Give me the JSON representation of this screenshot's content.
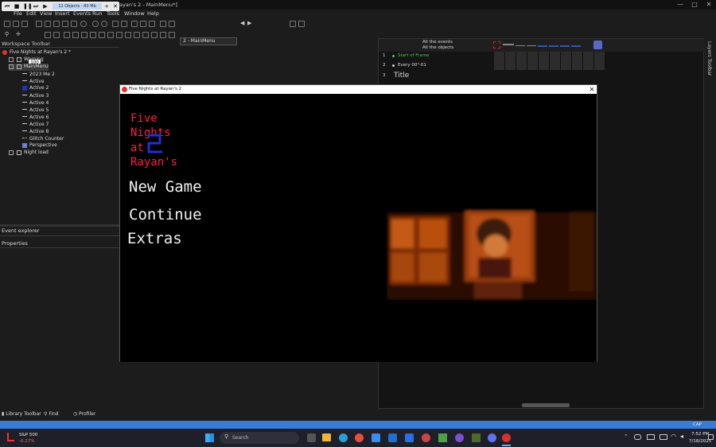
{
  "window": {
    "title": "ayan's 2 - MainMenu*]",
    "controls": [
      "—",
      "□",
      "✕"
    ]
  },
  "preview_toolbar": {
    "badge": "11 Objects - 80 Mb",
    "plus": "+",
    "close": "✕"
  },
  "menu": [
    "File",
    "Edit",
    "View",
    "Insert",
    "Events",
    "Run",
    "Tools",
    "Window",
    "Help"
  ],
  "toolbar": {
    "frame_select": "2 - MainMenu",
    "zoom": "100"
  },
  "workspace": {
    "title": "Workspace Toolbar",
    "project": "Five Nights at Rayan's 2 *",
    "frames": [
      {
        "label": "Warning"
      },
      {
        "label": "MainMenu"
      },
      {
        "label": "Night load"
      }
    ],
    "objects": [
      "2023 Me 2",
      "Active",
      "Active 2",
      "Active 3",
      "Active 4",
      "Active 5",
      "Active 6",
      "Active 7",
      "Active 8",
      "Glitch Counter",
      "Perspective"
    ]
  },
  "panels": {
    "event_explorer": "Event explorer",
    "properties": "Properties"
  },
  "event_editor": {
    "header_line1": "All the events",
    "header_line2": "All the objects",
    "rows": [
      {
        "num": "1",
        "text": "Start of Frame",
        "color": "#4fc24f"
      },
      {
        "num": "2",
        "text": "Every 00\"-01",
        "color": "#dddddd"
      },
      {
        "num": "3",
        "text": "Title",
        "color": "#dddddd"
      }
    ]
  },
  "layers_toolbar": "Layers Toolbar",
  "bottom_tabs": [
    "Library Toolbar",
    "Find",
    "Profiler"
  ],
  "statusbar": {
    "right": "CAP"
  },
  "taskbar": {
    "stock_name": "S&P 500",
    "stock_change": "-0.17%",
    "search_placeholder": "Search",
    "time": "7:52 PM",
    "date": "7/18/2025"
  },
  "game": {
    "window_title": "Five Nights at Rayan's 2",
    "title_lines": [
      "Five",
      "Nights",
      "at",
      "Rayan's"
    ],
    "options": {
      "new_game": "New Game",
      "continue": "Continue",
      "extras": "Extras"
    }
  },
  "colors": {
    "title_red": "#ff1f3f",
    "accent_blue": "#3a7bd5",
    "glow_orange": "#c85a14"
  }
}
